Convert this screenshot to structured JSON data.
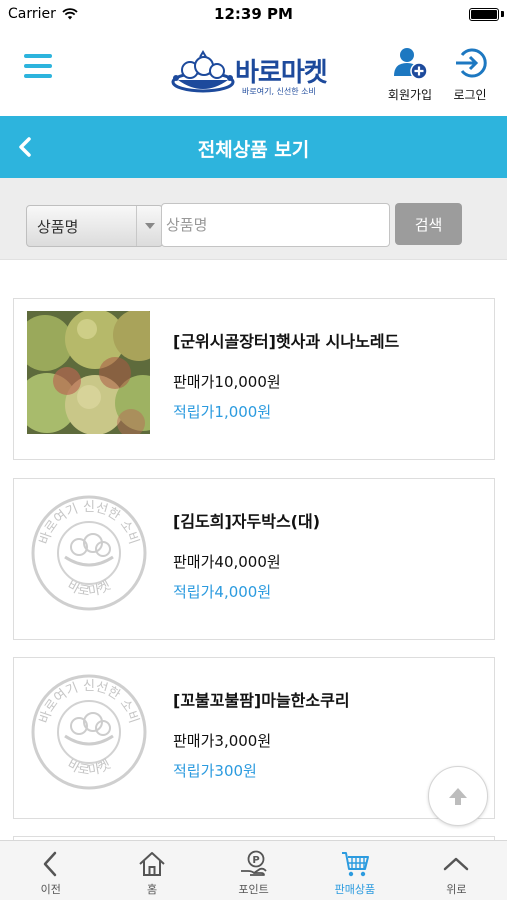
{
  "status_bar": {
    "carrier": "Carrier",
    "time": "12:39 PM"
  },
  "header": {
    "logo_text": "바로마켓",
    "logo_tagline": "바로여기, 신선한 소비",
    "signup_label": "회원가입",
    "login_label": "로그인"
  },
  "title_bar": {
    "title": "전체상품 보기"
  },
  "search": {
    "select_value": "상품명",
    "placeholder": "상품명",
    "button_label": "검색"
  },
  "products": [
    {
      "name": "[군위시골장터]햇사과 시나노레드",
      "price": "판매가10,000원",
      "points": "적립가1,000원",
      "thumb": "photo"
    },
    {
      "name": "[김도희]자두박스(대)",
      "price": "판매가40,000원",
      "points": "적립가4,000원",
      "thumb": "stamp"
    },
    {
      "name": "[꼬불꼬불팜]마늘한소쿠리",
      "price": "판매가3,000원",
      "points": "적립가300원",
      "thumb": "stamp"
    }
  ],
  "stamp": {
    "top_text": "바로여기 신선한 소비",
    "bottom_text": "바로마켓"
  },
  "bottom_nav": {
    "items": [
      {
        "label": "이전",
        "icon": "chevron-left-icon"
      },
      {
        "label": "홈",
        "icon": "home-icon"
      },
      {
        "label": "포인트",
        "icon": "point-hand-icon"
      },
      {
        "label": "판매상품",
        "icon": "cart-icon"
      },
      {
        "label": "위로",
        "icon": "chevron-up-icon"
      }
    ],
    "active_index": 3
  },
  "colors": {
    "accent": "#2db4dd",
    "brand": "#1d4a9c",
    "points": "#2c9bdf",
    "search_button": "#9c9c9c"
  }
}
